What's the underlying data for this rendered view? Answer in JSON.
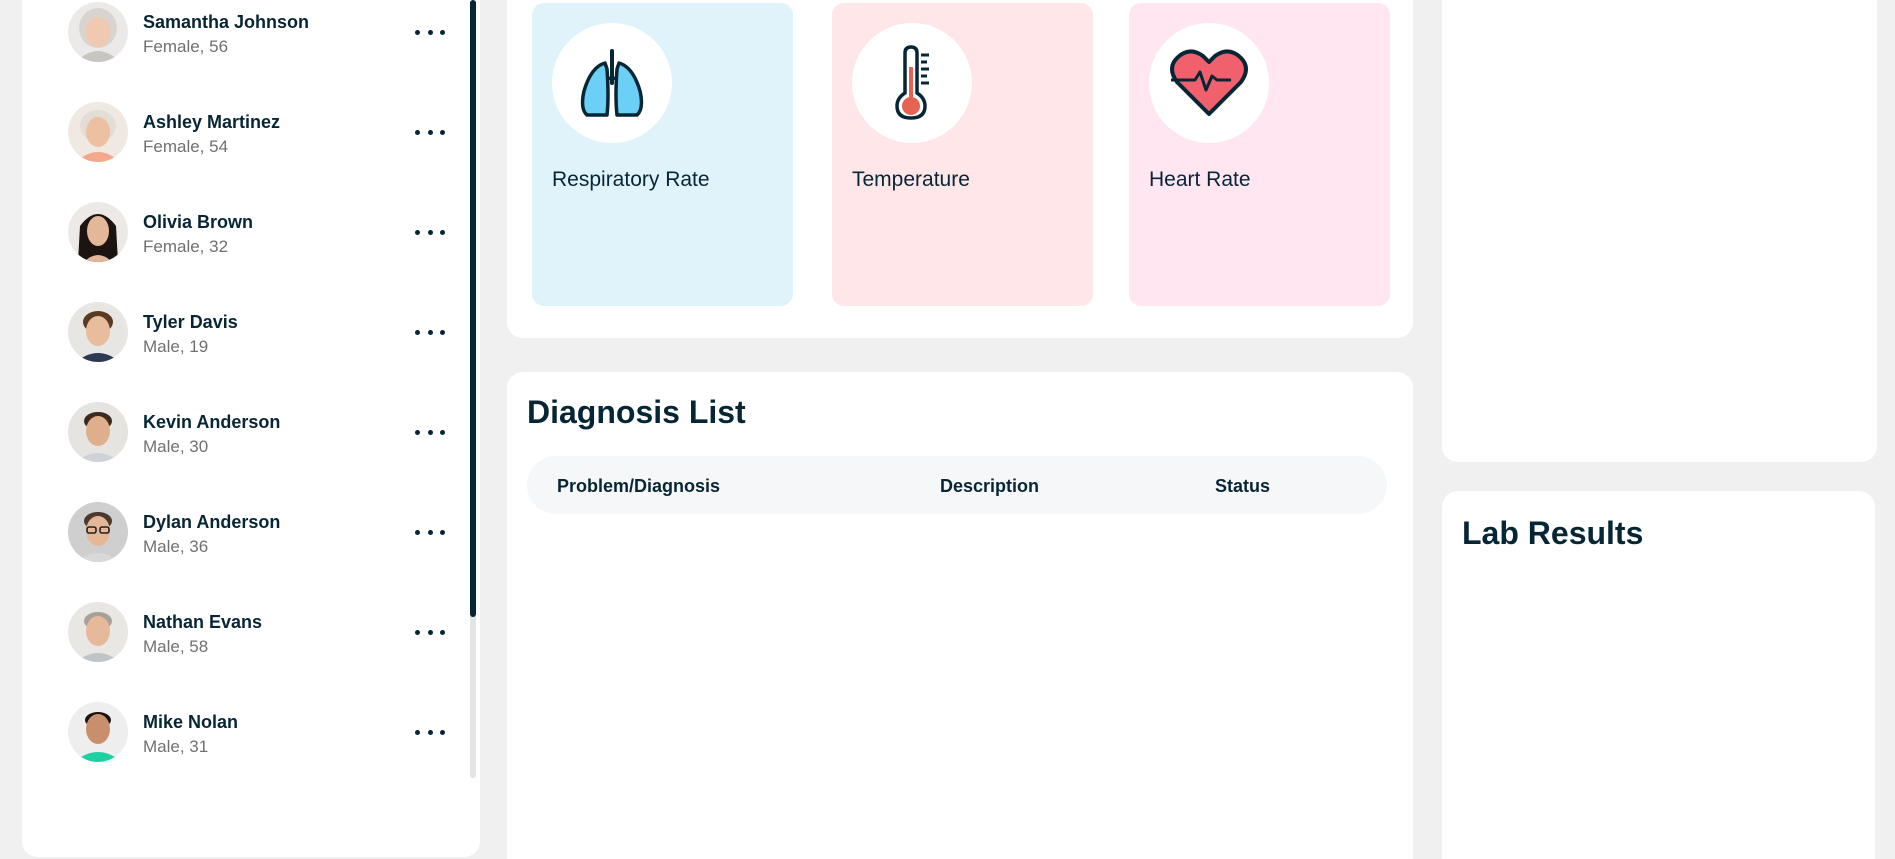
{
  "patients": [
    {
      "name": "Samantha Johnson",
      "meta": "Female, 56",
      "avatar_hair": "#d9d4cf",
      "avatar_bg": "#eceae8",
      "avatar_skin": "#f0c9b0"
    },
    {
      "name": "Ashley Martinez",
      "meta": "Female, 54",
      "avatar_hair": "#e2ddd6",
      "avatar_bg": "#efe9e2",
      "avatar_skin": "#eec0a2"
    },
    {
      "name": "Olivia Brown",
      "meta": "Female, 32",
      "avatar_hair": "#1c1410",
      "avatar_bg": "#ece9e6",
      "avatar_skin": "#e2b79a"
    },
    {
      "name": "Tyler Davis",
      "meta": "Male, 19",
      "avatar_hair": "#5a3b22",
      "avatar_bg": "#e8e6e3",
      "avatar_skin": "#e8bd9e"
    },
    {
      "name": "Kevin Anderson",
      "meta": "Male, 30",
      "avatar_hair": "#3c2a1c",
      "avatar_bg": "#e6e4e1",
      "avatar_skin": "#dfae8c"
    },
    {
      "name": "Dylan Anderson",
      "meta": "Male, 36",
      "avatar_hair": "#4a3a30",
      "avatar_bg": "#cfcfcf",
      "avatar_skin": "#e5b797"
    },
    {
      "name": "Nathan Evans",
      "meta": "Male, 58",
      "avatar_hair": "#a8a19a",
      "avatar_bg": "#e9e7e4",
      "avatar_skin": "#e6b99b"
    },
    {
      "name": "Mike Nolan",
      "meta": "Male, 31",
      "avatar_hair": "#1a1410",
      "avatar_bg": "#eeeeee",
      "avatar_skin": "#c98f6c"
    }
  ],
  "vitals": [
    {
      "label": "Respiratory Rate",
      "icon": "lungs-icon",
      "bg": "#e0f3fa"
    },
    {
      "label": "Temperature",
      "icon": "thermometer-icon",
      "bg": "#ffe6e9"
    },
    {
      "label": "Heart Rate",
      "icon": "heart-icon",
      "bg": "#ffe6f1"
    }
  ],
  "diagnosis_list": {
    "title": "Diagnosis List",
    "columns": [
      "Problem/Diagnosis",
      "Description",
      "Status"
    ]
  },
  "lab_results": {
    "title": "Lab Results"
  },
  "colors": {
    "text": "#072635",
    "muted": "#707070",
    "page_bg": "#f0f0f0",
    "scroll_thumb": "#072635"
  }
}
